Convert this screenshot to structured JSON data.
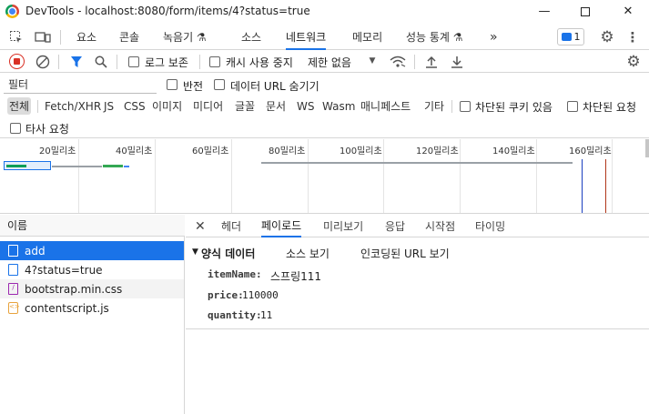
{
  "window": {
    "title": "DevTools - localhost:8080/form/items/4?status=true"
  },
  "main_tabs": [
    {
      "label": "요소"
    },
    {
      "label": "콘솔"
    },
    {
      "label": "녹음기 ⚗"
    },
    {
      "label": "소스"
    },
    {
      "label": "네트워크"
    },
    {
      "label": "메모리"
    },
    {
      "label": "성능 통계 ⚗"
    }
  ],
  "issues_badge": "1",
  "toolbar": {
    "preserve_log": "로그 보존",
    "disable_cache": "캐시 사용 중지",
    "throttle": "제한 없음"
  },
  "filter": {
    "placeholder": "필터",
    "invert": "반전",
    "hide_data_urls": "데이터 URL 숨기기"
  },
  "type_filters": [
    "전체",
    "Fetch/XHR",
    "JS",
    "CSS",
    "이미지",
    "미디어",
    "글꼴",
    "문서",
    "WS",
    "Wasm",
    "매니페스트",
    "기타"
  ],
  "blocked_cookies": "차단된 쿠키 있음",
  "blocked_requests": "차단된 요청",
  "third_party": "타사 요청",
  "overview": {
    "ticks": [
      "20밀리초",
      "40밀리초",
      "60밀리초",
      "80밀리초",
      "100밀리초",
      "120밀리초",
      "140밀리초",
      "160밀리초"
    ]
  },
  "requests": {
    "header": "이름",
    "items": [
      {
        "name": "add",
        "type": "document"
      },
      {
        "name": "4?status=true",
        "type": "document"
      },
      {
        "name": "bootstrap.min.css",
        "type": "stylesheet"
      },
      {
        "name": "contentscript.js",
        "type": "script"
      }
    ]
  },
  "detail": {
    "tabs": [
      "헤더",
      "페이로드",
      "미리보기",
      "응답",
      "시작점",
      "타이밍"
    ],
    "active_tab": "페이로드",
    "form_data_title": "양식 데이터",
    "view_source": "소스 보기",
    "view_url_encoded": "인코딩된 URL 보기",
    "fields": [
      {
        "key": "itemName:",
        "value": "스프링111"
      },
      {
        "key": "price:",
        "value": "110000"
      },
      {
        "key": "quantity:",
        "value": "11"
      }
    ]
  },
  "colors": {
    "accent": "#1a73e8",
    "record_red": "#d93025"
  }
}
